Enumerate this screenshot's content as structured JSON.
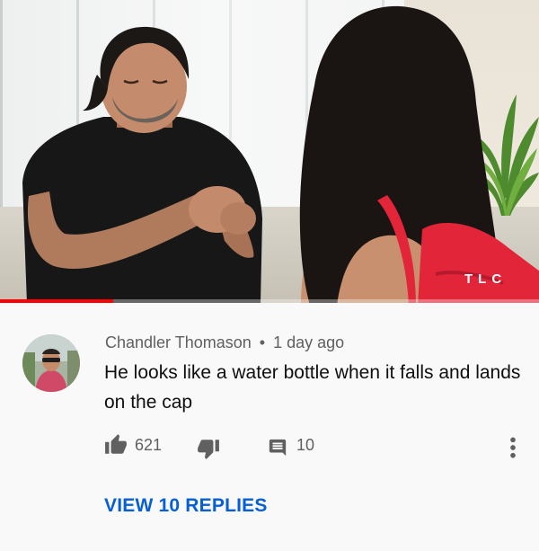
{
  "video": {
    "channel_logo": "TLC",
    "progress_percent": 21
  },
  "comment": {
    "author": "Chandler Thomason",
    "separator": "•",
    "timestamp": "1 day ago",
    "text": "He looks like a water bottle when it falls and lands on the cap",
    "likes": "621",
    "replies_count": "10",
    "view_replies_label": "VIEW 10 REPLIES"
  },
  "icons": {
    "like": "thumbs-up-icon",
    "dislike": "thumbs-down-icon",
    "reply": "comment-icon",
    "more": "more-vertical-icon"
  },
  "colors": {
    "link": "#065fd4",
    "progress": "#ff0000",
    "meta_text": "#606060",
    "background": "#f9f9f9"
  }
}
